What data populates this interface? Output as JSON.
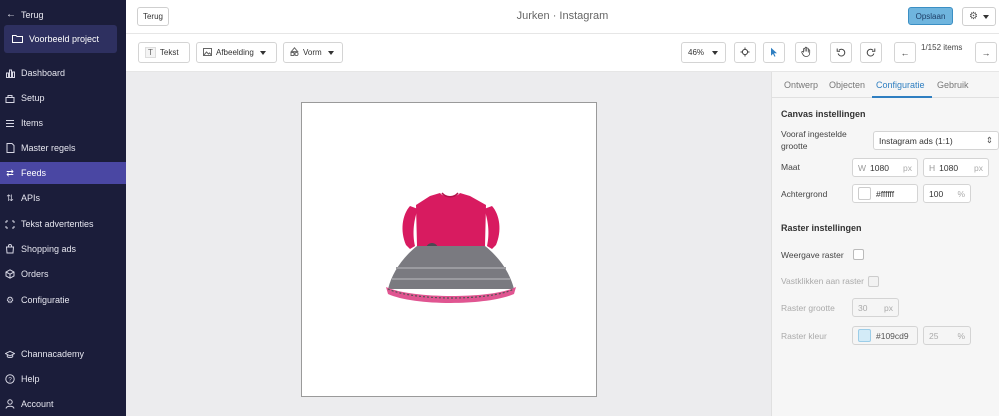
{
  "sidebar": {
    "back_label": "Terug",
    "project_label": "Voorbeeld project",
    "items": [
      {
        "label": "Dashboard",
        "icon": "dashboard-icon"
      },
      {
        "label": "Setup",
        "icon": "setup-icon"
      },
      {
        "label": "Items",
        "icon": "items-icon"
      },
      {
        "label": "Master regels",
        "icon": "rules-icon"
      },
      {
        "label": "Feeds",
        "icon": "feeds-icon",
        "active": true
      },
      {
        "label": "APIs",
        "icon": "apis-icon"
      },
      {
        "label": "Tekst advertenties",
        "icon": "text-ads-icon"
      },
      {
        "label": "Shopping ads",
        "icon": "shopping-icon"
      },
      {
        "label": "Orders",
        "icon": "orders-icon"
      },
      {
        "label": "Configuratie",
        "icon": "gear-icon"
      }
    ],
    "bottom_items": [
      {
        "label": "Channacademy",
        "icon": "academy-icon"
      },
      {
        "label": "Help",
        "icon": "help-icon"
      },
      {
        "label": "Account",
        "icon": "account-icon"
      }
    ]
  },
  "topbar": {
    "back_button": "Terug",
    "title": "Jurken · Instagram",
    "save_button": "Opslaan"
  },
  "toolbar": {
    "text_button": "Tekst",
    "image_button": "Afbeelding",
    "shape_button": "Vorm",
    "zoom": "46%",
    "pager": "1/152 items"
  },
  "panel": {
    "tabs": [
      "Ontwerp",
      "Objecten",
      "Configuratie",
      "Gebruik"
    ],
    "active_tab": "Configuratie",
    "canvas_section": "Canvas instellingen",
    "preset_label": "Vooraf ingestelde grootte",
    "preset_value": "Instagram ads (1:1)",
    "size_label": "Maat",
    "width_prefix": "W",
    "width_value": "1080",
    "height_prefix": "H",
    "height_value": "1080",
    "unit_px": "px",
    "background_label": "Achtergrond",
    "background_value": "#ffffff",
    "background_opacity": "100",
    "unit_percent": "%",
    "grid_section": "Raster instellingen",
    "show_grid_label": "Weergave raster",
    "snap_grid_label": "Vastklikken aan raster",
    "grid_size_label": "Raster grootte",
    "grid_size_value": "30",
    "grid_color_label": "Raster kleur",
    "grid_color_value": "#109cd9",
    "grid_opacity_value": "25"
  },
  "colors": {
    "sidebar_bg": "#1b1d3a",
    "sidebar_active": "#4a47a3",
    "accent": "#2f7fc1",
    "save_button": "#6fb5de",
    "dress_top": "#d81b60",
    "dress_skirt": "#6b6b70"
  }
}
